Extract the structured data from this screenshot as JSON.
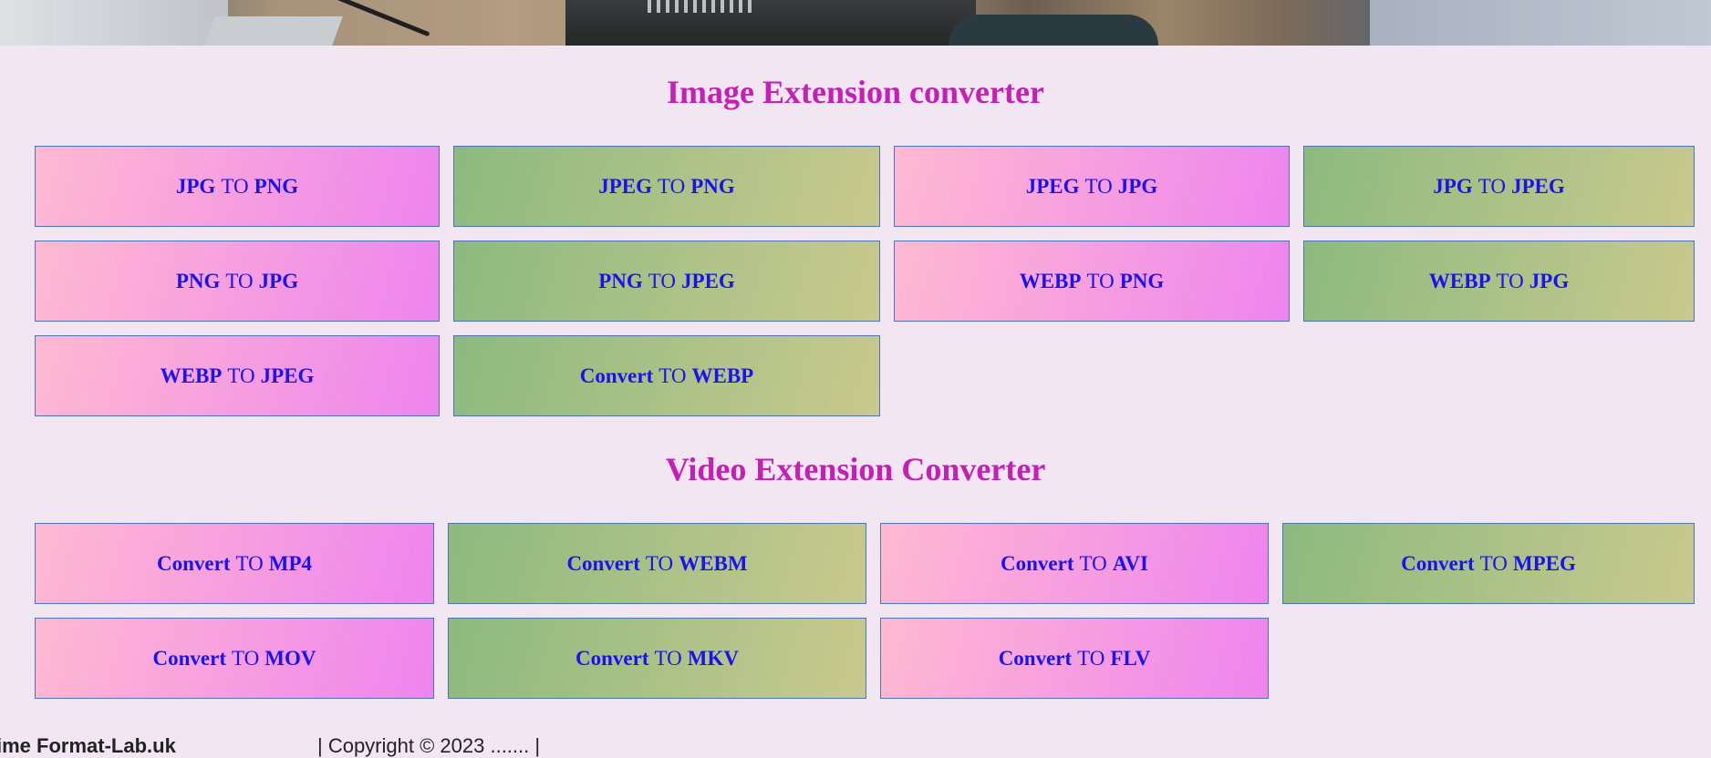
{
  "image_section": {
    "title": "Image Extension converter",
    "buttons": [
      {
        "from": "JPG",
        "to": "PNG",
        "style": "pink"
      },
      {
        "from": "JPEG",
        "to": "PNG",
        "style": "green"
      },
      {
        "from": "JPEG",
        "to": "JPG",
        "style": "pink"
      },
      {
        "from": "JPG",
        "to": "JPEG",
        "style": "green"
      },
      {
        "from": "PNG",
        "to": "JPG",
        "style": "pink"
      },
      {
        "from": "PNG",
        "to": "JPEG",
        "style": "green"
      },
      {
        "from": "WEBP",
        "to": "PNG",
        "style": "pink"
      },
      {
        "from": "WEBP",
        "to": "JPG",
        "style": "green"
      },
      {
        "from": "WEBP",
        "to": "JPEG",
        "style": "pink"
      },
      {
        "from": "Convert",
        "to": "WEBP",
        "style": "green"
      }
    ]
  },
  "video_section": {
    "title": "Video Extension Converter",
    "buttons": [
      {
        "from": "Convert",
        "to": "MP4",
        "style": "pink"
      },
      {
        "from": "Convert",
        "to": "WEBM",
        "style": "green"
      },
      {
        "from": "Convert",
        "to": "AVI",
        "style": "pink"
      },
      {
        "from": "Convert",
        "to": "MPEG",
        "style": "green"
      },
      {
        "from": "Convert",
        "to": "MOV",
        "style": "pink"
      },
      {
        "from": "Convert",
        "to": "MKV",
        "style": "green"
      },
      {
        "from": "Convert",
        "to": "FLV",
        "style": "pink"
      }
    ]
  },
  "to_word": "TO",
  "footer": {
    "brand": "ime Format-Lab.uk",
    "copyright": "| Copyright © 2023 ....... |"
  },
  "colors": {
    "heading": "#c51fb8",
    "button_text": "#1a13f0",
    "page_background": "#f2e6f2"
  }
}
